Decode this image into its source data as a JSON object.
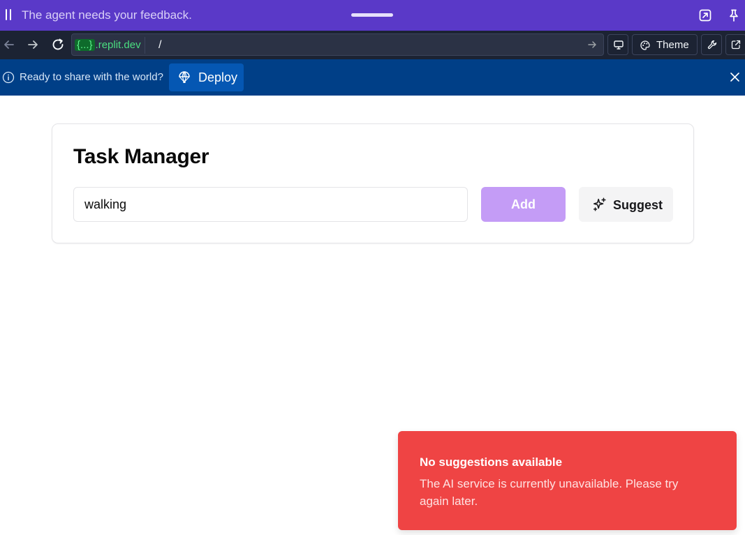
{
  "agent_bar": {
    "message": "The agent needs your feedback."
  },
  "browser": {
    "url_domain_brace": "{...}",
    "url_domain_suffix": ".replit.dev",
    "url_path": "/",
    "theme_label": "Theme"
  },
  "banner": {
    "text": "Ready to share with the world?",
    "deploy_label": "Deploy"
  },
  "app": {
    "title": "Task Manager",
    "task_input_value": "walking",
    "add_label": "Add",
    "suggest_label": "Suggest"
  },
  "toast": {
    "title": "No suggestions available",
    "description": "The AI service is currently unavailable. Please try again later."
  },
  "colors": {
    "agent_bar": "#5a39c8",
    "toolbar": "#1c2333",
    "banner": "#003f87",
    "deploy_button": "#0557b3",
    "add_button": "#c49cf6",
    "toast": "#ef4444"
  },
  "icons": {
    "agent_bar": [
      "grip-icon",
      "expand-icon",
      "pin-icon"
    ],
    "toolbar": [
      "back-arrow-icon",
      "forward-arrow-icon",
      "refresh-icon",
      "go-arrow-icon",
      "monitor-icon",
      "palette-icon",
      "wrench-icon",
      "external-link-icon"
    ],
    "banner": [
      "info-icon",
      "deploy-icon",
      "close-icon"
    ],
    "card": [
      "sparkles-icon"
    ]
  }
}
